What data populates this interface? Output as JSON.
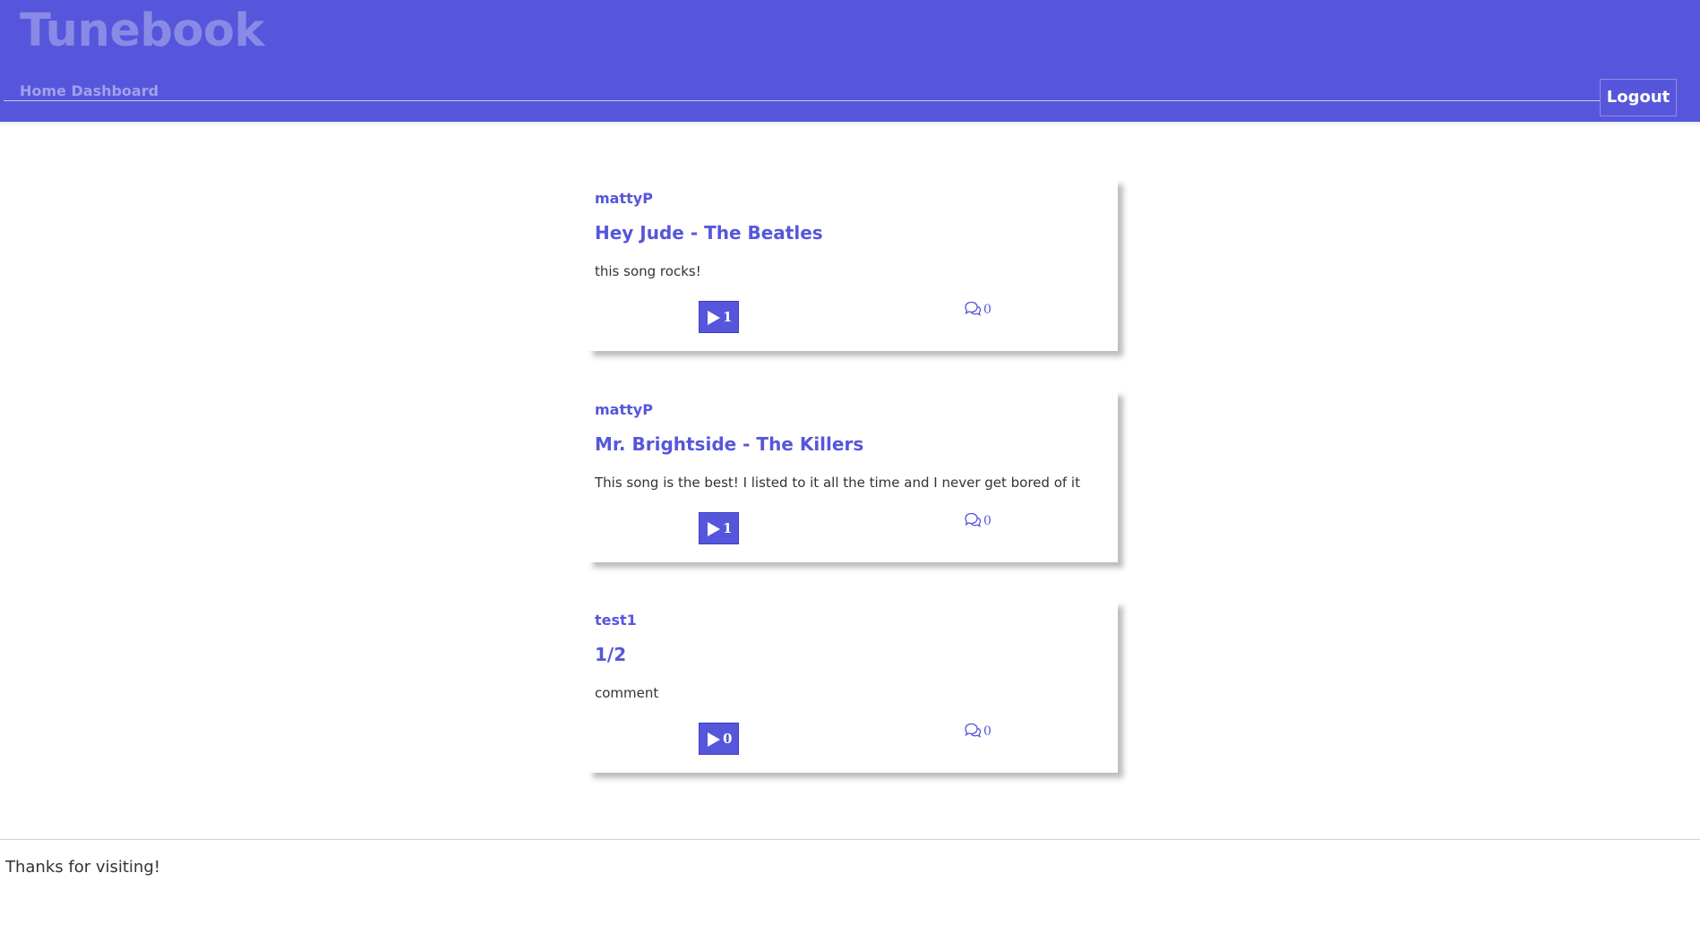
{
  "app": {
    "brand": "Tunebook"
  },
  "nav": {
    "links": [
      "Home",
      "Dashboard"
    ],
    "logout_label": "Logout"
  },
  "posts": [
    {
      "user": "mattyP",
      "title": "Hey Jude - The Beatles",
      "comment": "this song rocks!",
      "plays": "1",
      "comments": "0"
    },
    {
      "user": "mattyP",
      "title": "Mr. Brightside - The Killers",
      "comment": "This song is the best! I listed to it all the time and I never get bored of it",
      "plays": "1",
      "comments": "0"
    },
    {
      "user": "test1",
      "title": "1/2",
      "comment": "comment",
      "plays": "0",
      "comments": "0"
    }
  ],
  "footer": {
    "text": "Thanks for visiting!"
  },
  "colors": {
    "brand": "#5656dc",
    "brand_muted": "#8a8ae6",
    "text": "#333333"
  },
  "icons": {
    "play": "play-icon",
    "comments": "comments-icon"
  }
}
